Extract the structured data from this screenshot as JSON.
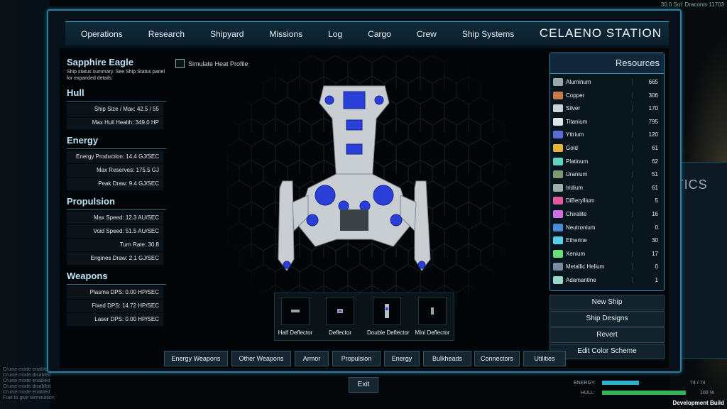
{
  "background": {
    "coords": "30.0 Sol: Draconis 11703",
    "statics_fragment": "ATICS",
    "log_lines": [
      "Cruise mode enabled",
      "Cruise mode disabled",
      "Cruise mode enabled",
      "Cruise mode disabled",
      "Cruise mode enabled",
      "Fuel to give termination"
    ],
    "energy_label": "ENERGY:",
    "energy_value": "74 / 74",
    "hull_label": "HULL:",
    "hull_value": "100 %",
    "dev_build": "Development Build"
  },
  "nav": {
    "items": [
      "Operations",
      "Research",
      "Shipyard",
      "Missions",
      "Log",
      "Cargo",
      "Crew",
      "Ship Systems"
    ],
    "station_title": "CELAENO STATION"
  },
  "ship": {
    "name": "Sapphire Eagle",
    "summary": "Ship status summary. See Ship Status panel for expanded details.",
    "sections": [
      {
        "title": "Hull",
        "rows": [
          "Ship Size / Max: 42.5 / 55",
          "Max Hull Health: 349.0 HP"
        ]
      },
      {
        "title": "Energy",
        "rows": [
          "Energy Production: 14.4 GJ/SEC",
          "Max Reserves: 175.5 GJ",
          "Peak Draw: 9.4 GJ/SEC"
        ]
      },
      {
        "title": "Propulsion",
        "rows": [
          "Max Speed: 12.3 AU/SEC",
          "Void Speed: 51.5 AU/SEC",
          "Turn Rate: 30.8",
          "Engines Draw: 2.1 GJ/SEC"
        ]
      },
      {
        "title": "Weapons",
        "rows": [
          "Plasma DPS: 0.00 HP/SEC",
          "Fixed DPS: 14.72 HP/SEC",
          "Laser DPS: 0.00 HP/SEC"
        ]
      }
    ]
  },
  "heat_profile_label": "Simulate Heat Profile",
  "components": [
    "Half Deflector",
    "Deflector",
    "Double Deflector",
    "Mini Deflector"
  ],
  "resources": {
    "title": "Resources",
    "items": [
      {
        "name": "Aluminum",
        "value": "665",
        "color": "#9aa7ad"
      },
      {
        "name": "Copper",
        "value": "306",
        "color": "#c87a4a"
      },
      {
        "name": "Silver",
        "value": "170",
        "color": "#c9d3d8"
      },
      {
        "name": "Titanium",
        "value": "795",
        "color": "#dfe6ea"
      },
      {
        "name": "Yttrium",
        "value": "120",
        "color": "#5a6ad8"
      },
      {
        "name": "Gold",
        "value": "61",
        "color": "#e3b53a"
      },
      {
        "name": "Platinum",
        "value": "62",
        "color": "#5fd2c0"
      },
      {
        "name": "Uranium",
        "value": "51",
        "color": "#7a9a72"
      },
      {
        "name": "Iridium",
        "value": "61",
        "color": "#9ab0a8"
      },
      {
        "name": "DiBeryllium",
        "value": "5",
        "color": "#e05aa0"
      },
      {
        "name": "Chiralite",
        "value": "16",
        "color": "#d070e0"
      },
      {
        "name": "Neutronium",
        "value": "0",
        "color": "#4a8ad8"
      },
      {
        "name": "Etherine",
        "value": "30",
        "color": "#5ad0e8"
      },
      {
        "name": "Xenium",
        "value": "17",
        "color": "#6ae07a"
      },
      {
        "name": "Metallic Helium",
        "value": "0",
        "color": "#7a8aa0"
      },
      {
        "name": "Adamantine",
        "value": "1",
        "color": "#9ad8c8"
      }
    ]
  },
  "actions": [
    "New Ship",
    "Ship Designs",
    "Revert",
    "Edit Color Scheme"
  ],
  "categories": [
    "Energy Weapons",
    "Other Weapons",
    "Armor",
    "Propulsion",
    "Energy",
    "Bulkheads",
    "Connectors",
    "Utilities"
  ],
  "exit_label": "Exit"
}
